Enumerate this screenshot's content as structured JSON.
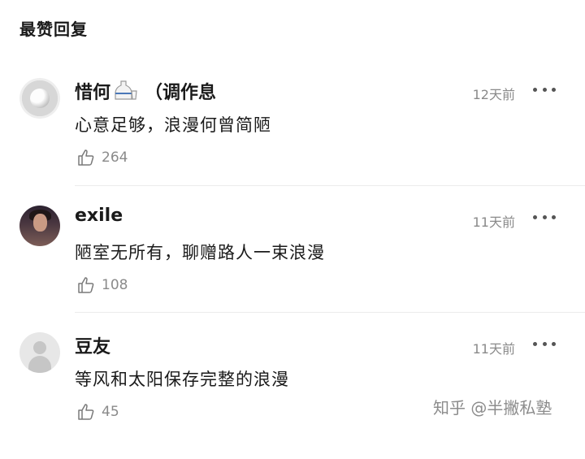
{
  "section_title": "最赞回复",
  "comments": [
    {
      "username": "惜何",
      "username_suffix": "（调作息",
      "timestamp": "12天前",
      "text": "心意足够，浪漫何曾简陋",
      "likes": "264"
    },
    {
      "username": "exile",
      "timestamp": "11天前",
      "text": "陋室无所有，聊赠路人一束浪漫",
      "likes": "108"
    },
    {
      "username": "豆友",
      "timestamp": "11天前",
      "text": "等风和太阳保存完整的浪漫",
      "likes": "45"
    }
  ],
  "watermark": "知乎 @半撇私塾",
  "icons": {
    "like": "thumbs-up-icon",
    "more": "more-dots-icon",
    "emoji": "sake-bottle-icon"
  }
}
